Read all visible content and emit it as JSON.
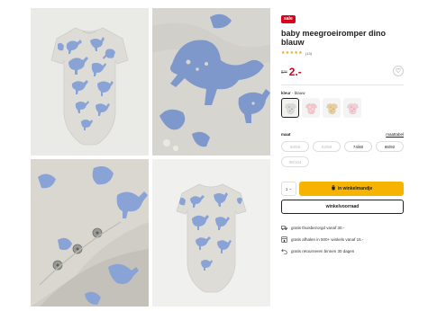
{
  "gallery": {
    "images": [
      {
        "name": "front-view"
      },
      {
        "name": "detail-print"
      },
      {
        "name": "snap-buttons"
      },
      {
        "name": "back-view"
      }
    ]
  },
  "product": {
    "badge": "sale",
    "title": "baby meegroeiromper dino blauw",
    "stars": "★★★★★",
    "rating_count": "(13)",
    "old_price": "6⁰⁰",
    "price": "2.-",
    "favorite_icon": "heart-icon"
  },
  "color": {
    "label": "kleur",
    "selected": "- blauw",
    "swatches": [
      {
        "name": "blauw",
        "color": "#dcdad6",
        "print": "#8aa3d6"
      },
      {
        "name": "roze",
        "color": "#f4c5c9",
        "print": "#ffffff"
      },
      {
        "name": "geel",
        "color": "#e8cf9a",
        "print": "#c9a76a"
      },
      {
        "name": "roze-print",
        "color": "#f3cdd6",
        "print": "#e88aa0"
      }
    ]
  },
  "size": {
    "label": "maat",
    "guide_link": "maattabel",
    "options": [
      {
        "label": "50/56",
        "available": false
      },
      {
        "label": "62/68",
        "available": false
      },
      {
        "label": "74/80",
        "available": true
      },
      {
        "label": "86/92",
        "available": true
      },
      {
        "label": "98/104",
        "available": false
      }
    ]
  },
  "cart": {
    "quantity": "1",
    "quantity_arrow": "⌄",
    "add_label": "in winkelmandje",
    "reserve_label": "winkelvoorraad"
  },
  "benefits": [
    {
      "icon": "truck-icon",
      "text": "gratis thuisbezorgd vanaf 30.-"
    },
    {
      "icon": "store-icon",
      "text": "gratis afhalen in 500+ winkels vanaf 15.-"
    },
    {
      "icon": "return-icon",
      "text": "gratis retourneren binnen 30 dagen"
    }
  ],
  "colors": {
    "sale_red": "#d6001c",
    "cta_yellow": "#f6b400",
    "fabric": "#dcdad6",
    "print_blue": "#8aa3d6"
  }
}
